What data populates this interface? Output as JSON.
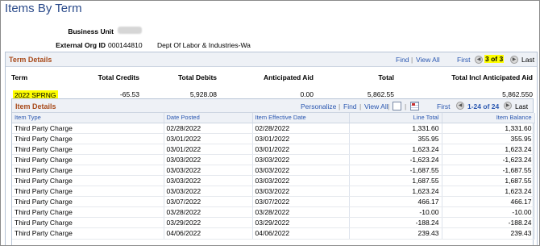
{
  "page_title": "Items By Term",
  "business_unit": {
    "label": "Business Unit"
  },
  "external_org": {
    "label": "External Org ID",
    "id": "000144810",
    "name": "Dept Of Labor & Industries-Wa"
  },
  "term_details": {
    "title": "Term Details",
    "find": "Find",
    "view_all": "View All",
    "first": "First",
    "range": "3 of 3",
    "last": "Last",
    "columns": [
      "Term",
      "Total Credits",
      "Total Debits",
      "Anticipated Aid",
      "Total",
      "Total Incl Anticipated Aid"
    ],
    "row": {
      "term": "2022 SPRNG",
      "total_credits": "-65.53",
      "total_debits": "5,928.08",
      "anticipated_aid": "0.00",
      "total": "5,862.55",
      "total_incl": "5,862.550"
    }
  },
  "item_details": {
    "title": "Item Details",
    "personalize": "Personalize",
    "find": "Find",
    "view_all": "View All",
    "first": "First",
    "range": "1-24 of 24",
    "last": "Last",
    "columns": [
      "Item Type",
      "Date Posted",
      "Item Effective Date",
      "Line Total",
      "Item Balance"
    ],
    "rows": [
      [
        "Third Party Charge",
        "02/28/2022",
        "02/28/2022",
        "1,331.60",
        "1,331.60"
      ],
      [
        "Third Party Charge",
        "03/01/2022",
        "03/01/2022",
        "355.95",
        "355.95"
      ],
      [
        "Third Party Charge",
        "03/01/2022",
        "03/01/2022",
        "1,623.24",
        "1,623.24"
      ],
      [
        "Third Party Charge",
        "03/03/2022",
        "03/03/2022",
        "-1,623.24",
        "-1,623.24"
      ],
      [
        "Third Party Charge",
        "03/03/2022",
        "03/03/2022",
        "-1,687.55",
        "-1,687.55"
      ],
      [
        "Third Party Charge",
        "03/03/2022",
        "03/03/2022",
        "1,687.55",
        "1,687.55"
      ],
      [
        "Third Party Charge",
        "03/03/2022",
        "03/03/2022",
        "1,623.24",
        "1,623.24"
      ],
      [
        "Third Party Charge",
        "03/07/2022",
        "03/07/2022",
        "466.17",
        "466.17"
      ],
      [
        "Third Party Charge",
        "03/28/2022",
        "03/28/2022",
        "-10.00",
        "-10.00"
      ],
      [
        "Third Party Charge",
        "03/29/2022",
        "03/29/2022",
        "-188.24",
        "-188.24"
      ],
      [
        "Third Party Charge",
        "04/06/2022",
        "04/06/2022",
        "239.43",
        "239.43"
      ]
    ]
  },
  "icons": {
    "prev": "chevron-left-icon",
    "next": "chevron-right-icon",
    "zoom": "zoom-icon",
    "export": "spreadsheet-icon"
  },
  "colors": {
    "section_title": "#a84a1a",
    "link": "#2a57b0",
    "page_title": "#2a4a8a",
    "highlight": "#ffff00"
  }
}
